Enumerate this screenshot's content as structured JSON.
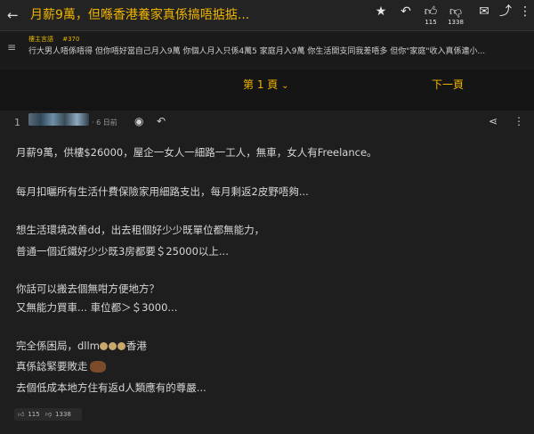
{
  "header": {
    "back_icon": "back-arrow-icon",
    "title": "月薪9萬，但喺香港養家真係搞唔掂掂...",
    "like_count": "115",
    "dislike_count": "1338"
  },
  "pinned": {
    "tag": "樓主言語",
    "number": "#370",
    "text": "行大男人唔係唔得 但你唔好當自己月入9萬 你個人月入只係4萬5 家庭月入9萬 你生活開支同我差唔多 但你\"家庭\"收入真係連小..."
  },
  "pager": {
    "current": "第 1 頁",
    "next": "下一頁"
  },
  "post": {
    "number": "1",
    "time": "· 6 日前",
    "lines": [
      "月薪9萬，供樓$26000，屋企一女人一細路一工人，無車，女人有Freelance。",
      "每月扣曬所有生活什費保險家用細路支出，每月剩返2皮野唔夠...",
      "想生活環境改善dd，出去租個好少少既單位都無能力，",
      "普通一個近鐵好少少既3房都要＄25000以上...",
      "你話可以搬去個無咁方便地方？",
      "又無能力買車... 車位都＞＄3000...",
      "完全係困局，dllm",
      "香港",
      "真係諗緊要敗走",
      "去個低成本地方住有返d人類應有的尊嚴..."
    ],
    "likes": "115",
    "dislikes": "1338"
  }
}
